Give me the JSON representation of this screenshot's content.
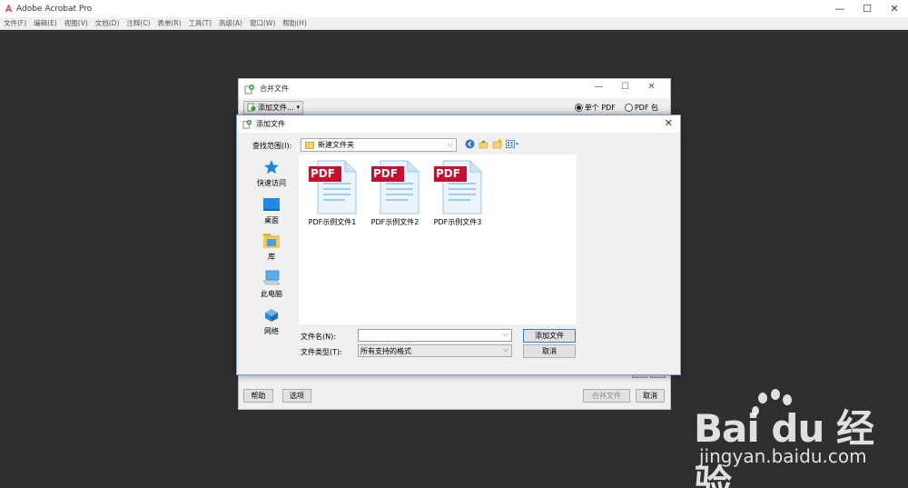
{
  "app": {
    "title": "Adobe Acrobat Pro",
    "menu": [
      "文件(F)",
      "编辑(E)",
      "视图(V)",
      "文档(D)",
      "注释(C)",
      "表单(R)",
      "工具(T)",
      "高级(A)",
      "窗口(W)",
      "帮助(H)"
    ],
    "controls": {
      "minimize": "—",
      "maximize": "☐",
      "close": "✕"
    }
  },
  "merge_dialog": {
    "title": "合并文件",
    "add_files_button": "添加文件...",
    "add_files_arrow": "▾",
    "options": [
      {
        "label": "单个 PDF",
        "selected": true
      },
      {
        "label": "PDF 包",
        "selected": false
      }
    ],
    "controls": {
      "minimize": "—",
      "maximize": "☐",
      "close": "✕"
    },
    "help_button": "帮助",
    "options_button": "选项",
    "merge_button": "合并文件",
    "cancel_button": "取消"
  },
  "add_dialog": {
    "title": "添加文件",
    "close": "✕",
    "look_in_label": "查找范围(I):",
    "look_in_value": "新建文件夹",
    "dropdown_arrow": "⌵",
    "places": [
      {
        "label": "快速访问",
        "icon": "star-icon"
      },
      {
        "label": "桌面",
        "icon": "desktop-icon"
      },
      {
        "label": "库",
        "icon": "library-icon"
      },
      {
        "label": "此电脑",
        "icon": "computer-icon"
      },
      {
        "label": "网络",
        "icon": "network-icon"
      }
    ],
    "files": [
      {
        "name": "PDF示例文件1",
        "badge": "PDF"
      },
      {
        "name": "PDF示例文件2",
        "badge": "PDF"
      },
      {
        "name": "PDF示例文件3",
        "badge": "PDF"
      }
    ],
    "file_name_label": "文件名(N):",
    "file_name_value": "",
    "file_type_label": "文件类型(T):",
    "file_type_value": "所有支持的格式",
    "add_button": "添加文件",
    "cancel_button": "取消"
  },
  "watermark": {
    "line1": "Bai du 经验",
    "line2": "jingyan.baidu.com"
  },
  "colors": {
    "background": "#2f2f2f",
    "pdf_badge": "#c8102e",
    "focus_blue": "#3c7fd1"
  }
}
